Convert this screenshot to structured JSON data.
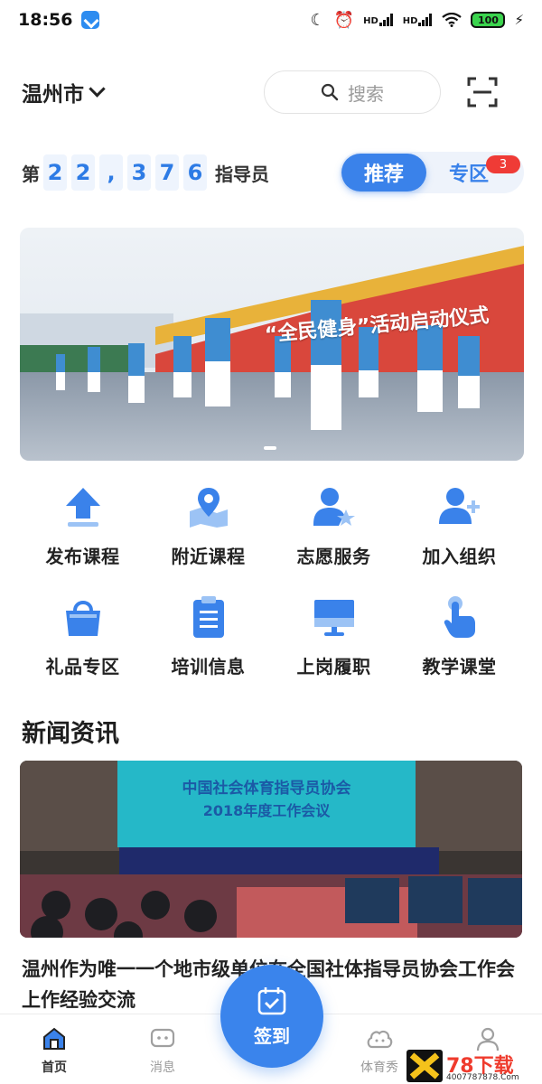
{
  "status_bar": {
    "time": "18:56",
    "battery": "100",
    "hd1": "HD",
    "hd2": "HD"
  },
  "header": {
    "city": "温州市",
    "search_placeholder": "搜索"
  },
  "counter": {
    "prefix": "第",
    "digits": [
      "2",
      "2",
      ",",
      "3",
      "7",
      "6"
    ],
    "suffix": "指导员"
  },
  "tabs": {
    "recommend": "推荐",
    "zone": "专区",
    "zone_badge": "3"
  },
  "banner": {
    "caption": "“全民健身”活动启动仪式"
  },
  "grid": [
    {
      "label": "发布课程",
      "icon": "upload-arrow-icon"
    },
    {
      "label": "附近课程",
      "icon": "map-pin-icon"
    },
    {
      "label": "志愿服务",
      "icon": "user-star-icon"
    },
    {
      "label": "加入组织",
      "icon": "user-add-icon"
    },
    {
      "label": "礼品专区",
      "icon": "gift-bag-icon"
    },
    {
      "label": "培训信息",
      "icon": "clipboard-icon"
    },
    {
      "label": "上岗履职",
      "icon": "monitor-icon"
    },
    {
      "label": "教学课堂",
      "icon": "tap-hand-icon"
    }
  ],
  "news": {
    "heading": "新闻资讯",
    "stage_line1": "中国社会体育指导员协会",
    "stage_line2": "2018年度工作会议",
    "title": "温州作为唯一一个地市级单位在全国社体指导员协会工作会上作经验交流"
  },
  "bottom_nav": {
    "home": "首页",
    "messages": "消息",
    "checkin": "签到",
    "show": "体育秀",
    "me": ""
  },
  "watermark": {
    "brand": "78下载",
    "url": "4007787878.Com"
  },
  "colors": {
    "accent": "#3a82ea",
    "badge": "#ef3b36"
  }
}
